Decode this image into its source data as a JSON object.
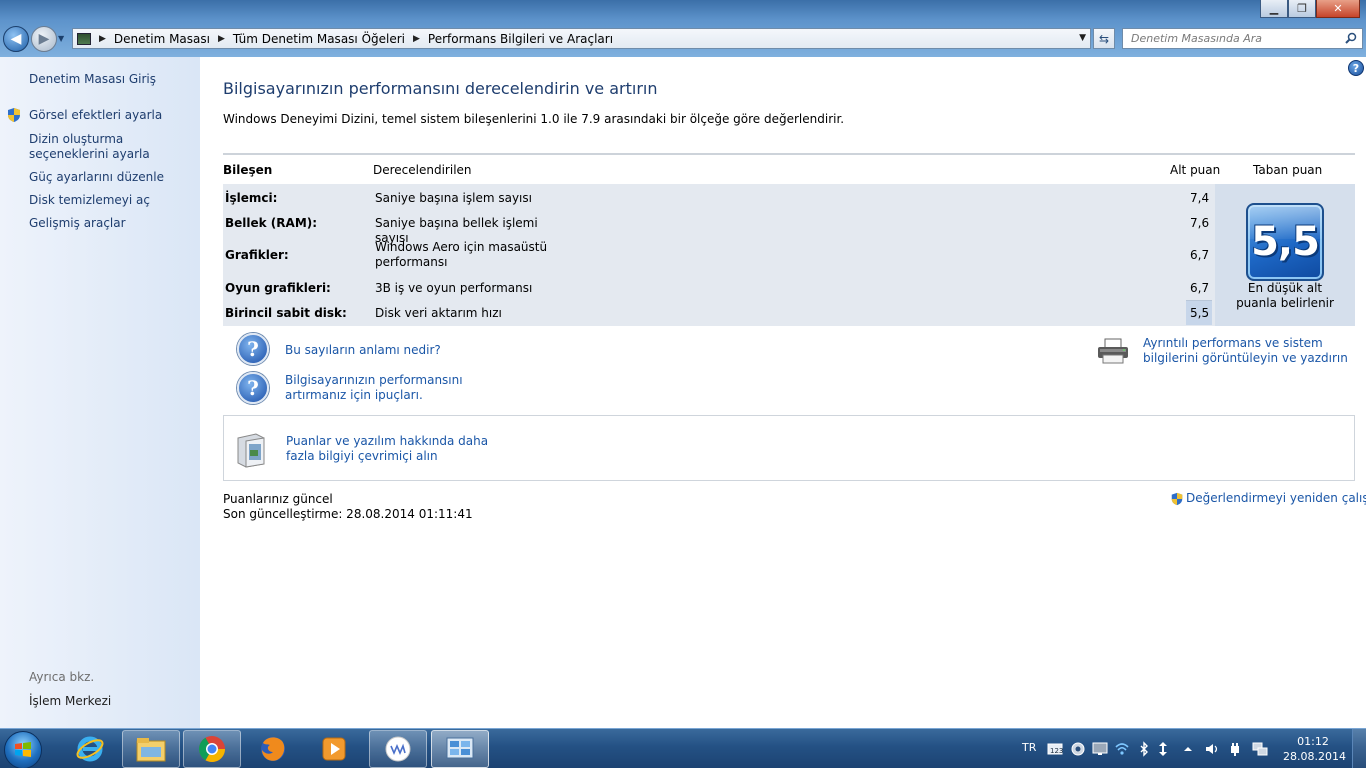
{
  "window": {
    "minimize_glyph": "▁",
    "maximize_glyph": "❐",
    "close_glyph": "✕"
  },
  "address_bar": {
    "crumbs": [
      "Denetim Masası",
      "Tüm Denetim Masası Öğeleri",
      "Performans Bilgileri ve Araçları"
    ]
  },
  "search": {
    "placeholder": "Denetim Masasında Ara"
  },
  "sidebar": {
    "home": "Denetim Masası Giriş",
    "links": [
      "Görsel efektleri ayarla",
      "Dizin oluşturma seçeneklerini ayarla",
      "Güç ayarlarını düzenle",
      "Disk temizlemeyi aç",
      "Gelişmiş araçlar"
    ],
    "see_also_label": "Ayrıca bkz.",
    "see_also_link": "İşlem Merkezi"
  },
  "main": {
    "title": "Bilgisayarınızın performansını derecelendirin ve artırın",
    "description": "Windows Deneyimi Dizini, temel sistem bileşenlerini 1.0 ile 7.9 arasındaki bir ölçeğe göre değerlendirir.",
    "table": {
      "headers": {
        "component": "Bileşen",
        "rated": "Derecelendirilen",
        "subscore": "Alt puan",
        "basescore": "Taban puan"
      },
      "rows": [
        {
          "component": "İşlemci:",
          "rated": "Saniye başına işlem sayısı",
          "subscore": "7,4"
        },
        {
          "component": "Bellek (RAM):",
          "rated": "Saniye başına bellek işlemi sayısı",
          "subscore": "7,6"
        },
        {
          "component": "Grafikler:",
          "rated": "Windows Aero için masaüstü performansı",
          "subscore": "6,7"
        },
        {
          "component": "Oyun grafikleri:",
          "rated": "3B iş ve oyun performansı",
          "subscore": "6,7"
        },
        {
          "component": "Birincil sabit disk:",
          "rated": "Disk veri aktarım hızı",
          "subscore": "5,5"
        }
      ],
      "base_score": "5,5",
      "base_caption": "En düşük alt puanla belirlenir"
    },
    "links": {
      "meaning": "Bu sayıların anlamı nedir?",
      "tips": "Bilgisayarınızın performansını artırmanız için ipuçları.",
      "details": "Ayrıntılı performans ve sistem bilgilerini görüntüleyin ve yazdırın",
      "online": "Puanlar ve yazılım hakkında daha fazla bilgiyi çevrimiçi alın",
      "rerun": "Değerlendirmeyi yeniden çalıştır"
    },
    "status": {
      "current": "Puanlarınız güncel",
      "updated": "Son güncelleştirme: 28.08.2014 01:11:41"
    }
  },
  "taskbar": {
    "apps": [
      "internet-explorer",
      "windows-explorer",
      "chrome",
      "firefox",
      "media-player",
      "vivaldi-app",
      "control-panel"
    ],
    "language": "TR",
    "time": "01:12",
    "date": "28.08.2014"
  },
  "colors": {
    "link": "#1a56a7",
    "title": "#1e3d6e",
    "sidebar_bg": "#dae6f6",
    "taskbar": "#245184"
  }
}
